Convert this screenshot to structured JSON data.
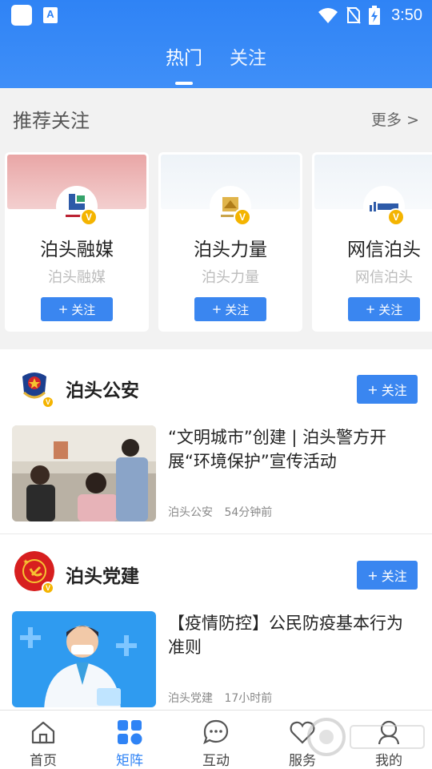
{
  "status_bar": {
    "time": "3:50",
    "app_icon_letter": "A"
  },
  "tabs": [
    {
      "label": "热门",
      "active": true
    },
    {
      "label": "关注",
      "active": false
    }
  ],
  "recommend": {
    "title": "推荐关注",
    "more": "更多 >",
    "cards": [
      {
        "name": "泊头融媒",
        "subtitle": "泊头融媒",
        "button": "关注",
        "verified": "V"
      },
      {
        "name": "泊头力量",
        "subtitle": "泊头力量",
        "button": "关注",
        "verified": "V"
      },
      {
        "name": "网信泊头",
        "subtitle": "网信泊头",
        "button": "关注",
        "verified": "V"
      }
    ]
  },
  "feed": [
    {
      "account": "泊头公安",
      "follow": "关注",
      "verified": "V",
      "article": {
        "title": "“文明城市”创建 | 泊头警方开展“环境保护”宣传活动",
        "source": "泊头公安",
        "time": "54分钟前"
      }
    },
    {
      "account": "泊头党建",
      "follow": "关注",
      "verified": "V",
      "article": {
        "title": "【疫情防控】公民防疫基本行为准则",
        "source": "泊头党建",
        "time": "17小时前"
      }
    }
  ],
  "bottom_nav": [
    {
      "label": "首页",
      "icon": "home-icon",
      "active": false
    },
    {
      "label": "矩阵",
      "icon": "grid-icon",
      "active": true
    },
    {
      "label": "互动",
      "icon": "chat-icon",
      "active": false
    },
    {
      "label": "服务",
      "icon": "heart-icon",
      "active": false
    },
    {
      "label": "我的",
      "icon": "user-icon",
      "active": false
    }
  ],
  "colors": {
    "accent": "#3a86f0",
    "header": "#2f83f5",
    "verified": "#f4b400"
  }
}
